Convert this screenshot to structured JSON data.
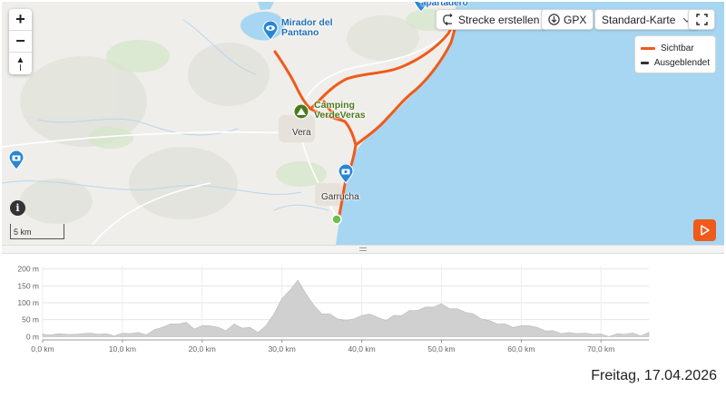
{
  "map": {
    "places": {
      "mirador": "Mirador del Pantano",
      "camping": "Camping VerdeVeras",
      "vera": "Vera",
      "garrucha": "Garrucha",
      "apartadero": "apartadero"
    },
    "icons": {
      "zoom_in": "plus-icon",
      "zoom_out": "minus-icon",
      "north": "compass-north-icon",
      "info": "info-icon",
      "fullscreen": "fullscreen-icon",
      "play": "play-icon",
      "poi_view": "viewpoint-icon",
      "poi_camp": "camping-icon",
      "poi_photo": "camera-icon"
    },
    "zoom_in": "+",
    "zoom_out": "−",
    "north_label": "▲",
    "info_label": "i",
    "scale": "5 km",
    "route_color": "#f05a1a",
    "sea_color": "#a6d6f1"
  },
  "toolbar": {
    "create_route": "Strecke erstellen",
    "gpx": "GPX",
    "map_type": "Standard-Karte"
  },
  "legend": {
    "visible": "Sichtbar",
    "hidden": "Ausgeblendet",
    "visible_color": "#f05a1a",
    "hidden_color": "#333333"
  },
  "chart_data": {
    "type": "area",
    "title": "",
    "xlabel": "",
    "ylabel": "",
    "x_ticks": [
      "0,0 km",
      "10,0 km",
      "20,0 km",
      "30,0 km",
      "40,0 km",
      "50,0 km",
      "60,0 km",
      "70,0 km"
    ],
    "y_ticks": [
      "0 m",
      "50 m",
      "100 m",
      "150 m",
      "200 m"
    ],
    "xlim": [
      0,
      76
    ],
    "ylim": [
      -10,
      210
    ],
    "grid": true,
    "fill_color": "#d0d0d0",
    "series": [
      {
        "x": [
          0,
          1,
          2,
          3,
          4,
          5,
          6,
          7,
          8,
          9,
          10,
          11,
          12,
          13,
          14,
          15,
          16,
          17,
          18,
          19,
          20,
          21,
          22,
          23,
          24,
          25,
          26,
          27,
          28,
          29,
          30,
          31,
          32,
          33,
          34,
          35,
          36,
          37,
          38,
          39,
          40,
          41,
          42,
          43,
          44,
          45,
          46,
          47,
          48,
          49,
          50,
          51,
          52,
          53,
          54,
          55,
          56,
          57,
          58,
          59,
          60,
          61,
          62,
          63,
          64,
          65,
          66,
          67,
          68,
          69,
          70,
          71,
          72,
          73,
          74,
          75,
          76
        ],
        "values": [
          5,
          8,
          6,
          10,
          4,
          12,
          8,
          10,
          6,
          5,
          8,
          12,
          10,
          8,
          18,
          30,
          35,
          40,
          40,
          25,
          30,
          35,
          25,
          20,
          35,
          28,
          25,
          15,
          30,
          70,
          110,
          140,
          165,
          130,
          90,
          70,
          65,
          55,
          45,
          55,
          60,
          70,
          55,
          50,
          60,
          65,
          75,
          80,
          85,
          90,
          95,
          85,
          80,
          75,
          65,
          55,
          45,
          40,
          35,
          30,
          30,
          35,
          25,
          20,
          15,
          12,
          10,
          12,
          8,
          10,
          5,
          3,
          6,
          10,
          8,
          5,
          10
        ]
      }
    ]
  },
  "date": "Freitag, 17.04.2026"
}
